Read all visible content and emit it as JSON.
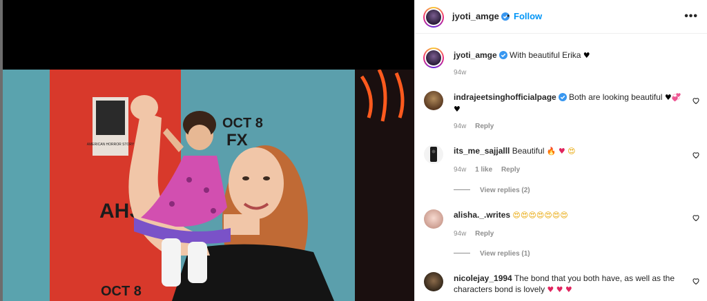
{
  "post": {
    "author": "jyoti_amge",
    "follow_label": "Follow",
    "separator": "•",
    "more_label": "•••",
    "caption_text": "With beautiful Erika",
    "caption_emoji": "♥",
    "caption_time": "94w"
  },
  "photo": {
    "sign_lines": [
      "OCT 8",
      "FX"
    ],
    "sign_bottom": "OCT 8",
    "side_text": "AHS",
    "poster_text": "AMERICAN HORROR STORY"
  },
  "comments": [
    {
      "user": "indrajeetsinghofficialpage",
      "verified": true,
      "text": "Both are looking beautiful",
      "emojis": [
        "♥",
        "💞",
        "♥"
      ],
      "time": "94w",
      "likes": "",
      "reply_label": "Reply",
      "view_replies": ""
    },
    {
      "user": "its_me_sajjalll",
      "verified": false,
      "text": "Beautiful",
      "emojis": [
        "🔥",
        "♥",
        "😍"
      ],
      "time": "94w",
      "likes": "1 like",
      "reply_label": "Reply",
      "view_replies": "View replies (2)"
    },
    {
      "user": "alisha._.writes",
      "verified": false,
      "text": "",
      "emojis": [
        "😍",
        "😍",
        "😍",
        "😍",
        "😍",
        "😍",
        "😍"
      ],
      "time": "94w",
      "likes": "",
      "reply_label": "Reply",
      "view_replies": "View replies (1)"
    },
    {
      "user": "nicolejay_1994",
      "verified": false,
      "text": "The bond that you both have, as well as the characters bond is lovely",
      "emojis": [
        "♥",
        "♥",
        "♥"
      ],
      "time": "",
      "likes": "",
      "reply_label": "",
      "view_replies": ""
    }
  ],
  "colors": {
    "accent": "#0095f6",
    "verified": "#3897f0",
    "muted": "#8e8e8e",
    "backdrop_red": "#d8392b",
    "backdrop_teal": "#4f9aa8"
  }
}
